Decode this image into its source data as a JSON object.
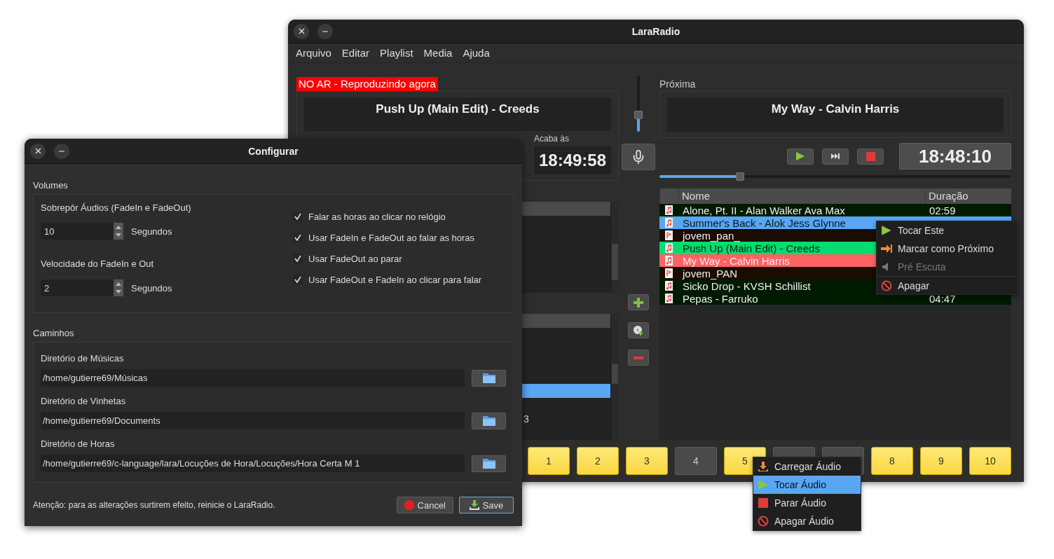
{
  "main_window": {
    "title": "LaraRadio",
    "menu": [
      "Arquivo",
      "Editar",
      "Playlist",
      "Media",
      "Ajuda"
    ],
    "on_air": {
      "label": "NO AR - Reproduzindo agora",
      "title": "Push Up (Main Edit) - Creeds",
      "ends_label": "Acaba às",
      "ends_time": "18:49:58"
    },
    "mic_volume": {
      "level": 0.3
    },
    "lower_list": {
      "rows": [
        {
          "selected": true
        },
        {
          "text": "3",
          "selected": false
        }
      ]
    },
    "next": {
      "label": "Próxima",
      "title": "My Way - Calvin Harris",
      "clock": "18:48:10",
      "seek": {
        "level": 0.23
      }
    },
    "playlist": {
      "columns": [
        "Nome",
        "Duração"
      ],
      "rows": [
        {
          "kind": "music",
          "name": "Alone, Pt. II - Alan Walker Ava Max",
          "duration": "02:59",
          "color": "#001a00",
          "selected": false
        },
        {
          "kind": "music",
          "name": "Summer's Back - Alok Jess Glynne",
          "selected": true
        },
        {
          "kind": "jingle",
          "name": "jovem_pan_",
          "color": "#1a0c00",
          "selected": false
        },
        {
          "kind": "music",
          "name": "Push Up (Main Edit) - Creeds",
          "color": "#00dd6e",
          "selected": false
        },
        {
          "kind": "music",
          "name": "My Way - Calvin Harris",
          "color": "#ff6262",
          "selected": false
        },
        {
          "kind": "jingle",
          "name": "jovem_PAN",
          "color": "#1a0c00",
          "selected": false
        },
        {
          "kind": "music",
          "name": "Sicko Drop - KVSH Schillist",
          "color": "#001a00",
          "selected": false
        },
        {
          "kind": "music",
          "name": "Pepas - Farruko",
          "duration": "04:47",
          "color": "#001a00",
          "selected": false
        }
      ]
    },
    "cart_buttons": [
      {
        "label": "1",
        "loaded": true
      },
      {
        "label": "2",
        "loaded": true
      },
      {
        "label": "3",
        "loaded": true
      },
      {
        "label": "4",
        "loaded": false
      },
      {
        "label": "5",
        "loaded": true
      },
      {
        "loaded": false
      },
      {
        "loaded": false
      },
      {
        "label": "8",
        "loaded": true
      },
      {
        "label": "9",
        "loaded": true
      },
      {
        "label": "10",
        "loaded": true
      }
    ],
    "playlist_menu": [
      {
        "kind": "play",
        "label": "Tocar Este",
        "disabled": false
      },
      {
        "kind": "next",
        "label": "Marcar como Próximo",
        "disabled": false
      },
      {
        "kind": "preview",
        "label": "Pré Escuta",
        "disabled": true
      },
      {
        "kind": "delete",
        "label": "Apagar",
        "disabled": false
      }
    ],
    "cart_menu": [
      {
        "kind": "load",
        "label": "Carregar Áudio",
        "selected": false
      },
      {
        "kind": "play",
        "label": "Tocar Áudio",
        "selected": true
      },
      {
        "kind": "stop",
        "label": "Parar Áudio",
        "selected": false
      },
      {
        "kind": "delete",
        "label": "Apagar Áudio",
        "selected": false
      }
    ]
  },
  "config_dialog": {
    "title": "Configurar",
    "volumes": {
      "label": "Volumes",
      "spins": [
        {
          "label": "Sobrepôr Áudios (FadeIn e FadeOut)",
          "value": "10",
          "unit": "Segundos"
        },
        {
          "label": "Velocidade do FadeIn e Out",
          "value": "2",
          "unit": "Segundos"
        }
      ],
      "checks": [
        {
          "label": "Falar as horas ao clicar no relógio",
          "checked": true
        },
        {
          "label": "Usar FadeIn e FadeOut ao falar as horas",
          "checked": true
        },
        {
          "label": "Usar FadeOut ao parar",
          "checked": true
        },
        {
          "label": "Usar FadeOut e FadeIn ao clicar para falar",
          "checked": true
        }
      ]
    },
    "paths": {
      "label": "Caminhos",
      "items": [
        {
          "label": "Diretório de Músicas",
          "value": "/home/gutierre69/Músicas"
        },
        {
          "label": "Diretório de Vinhetas",
          "value": "/home/gutierre69/Documents"
        },
        {
          "label": "Diretório de Horas",
          "value": "/home/gutierre69/c-language/lara/Locuções de Hora/Locuções/Hora Certa M 1"
        }
      ]
    },
    "note": "Atenção: para as alterações surtirem efeito, reinicie o LaraRadio.",
    "buttons": [
      {
        "kind": "cancel",
        "label": "Cancel",
        "default": false
      },
      {
        "kind": "save",
        "label": "Save",
        "default": true
      }
    ]
  }
}
